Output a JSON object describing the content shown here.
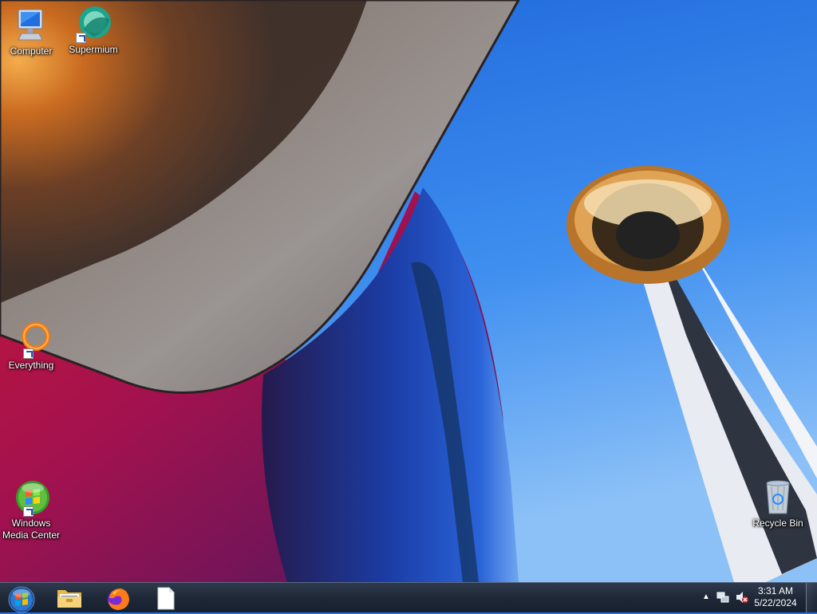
{
  "desktop": {
    "icons": {
      "computer": {
        "label": "Computer",
        "icon": "computer-icon"
      },
      "supermium": {
        "label": "Supermium",
        "icon": "supermium-icon"
      },
      "everything": {
        "label": "Everything",
        "icon": "everything-icon"
      },
      "media_center": {
        "label": "Windows Media Center",
        "icon": "windows-media-center-icon"
      },
      "recycle_bin": {
        "label": "Recycle Bin",
        "icon": "recycle-bin-icon"
      }
    },
    "wallpaper": "Space Needle and museum facade under blue sky"
  },
  "taskbar": {
    "pinned": [
      {
        "name": "start",
        "icon": "windows-start-orb-icon"
      },
      {
        "name": "file-explorer",
        "icon": "folder-icon"
      },
      {
        "name": "firefox",
        "icon": "firefox-icon"
      },
      {
        "name": "blank-document",
        "icon": "document-icon"
      }
    ],
    "tray": {
      "show_hidden": "show-hidden-icons-chevron",
      "network": "network-icon",
      "volume": "volume-muted-icon",
      "time": "3:31 AM",
      "date": "5/22/2024"
    }
  },
  "colors": {
    "sky": "#1c6fe0",
    "taskbar": "#1f2837",
    "label_text": "#ffffff"
  }
}
